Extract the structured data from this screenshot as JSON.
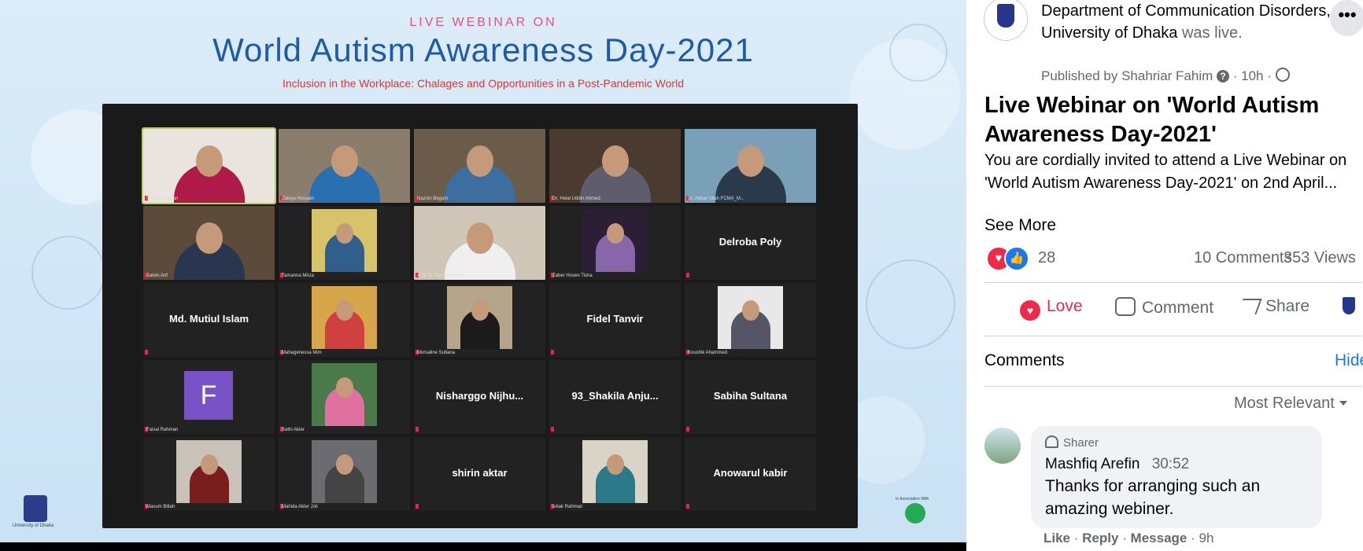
{
  "slide": {
    "kicker": "LIVE WEBINAR ON",
    "title": "World Autism Awareness Day-2021",
    "subtitle": "Inclusion in the Workplace: Chalages and Opportunities in a Post-Pandemic World",
    "logo_left_caption": "University of Dhaka",
    "logo_right_caption": "In Association With"
  },
  "participants": [
    {
      "caption": "Sharmin Jahan",
      "name": "",
      "kind": "video"
    },
    {
      "caption": "Zakiya Hossain",
      "name": "",
      "kind": "video"
    },
    {
      "caption": "Naznin Begum",
      "name": "",
      "kind": "video"
    },
    {
      "caption": "Dr. Helal Uddin Ahmed",
      "name": "",
      "kind": "video"
    },
    {
      "caption": "Dr. Akbar Ullah FCMA_M...",
      "name": "",
      "kind": "video"
    },
    {
      "caption": "Sakim Arif",
      "name": "",
      "kind": "video"
    },
    {
      "caption": "Tamanna Mirza",
      "name": "",
      "kind": "video-small"
    },
    {
      "caption": "A. K. M. Rakibul Karim",
      "name": "",
      "kind": "video"
    },
    {
      "caption": "Zaber Hosen Tisha",
      "name": "",
      "kind": "video-small"
    },
    {
      "caption": "",
      "name": "Delroba Poly",
      "kind": "name"
    },
    {
      "caption": "",
      "name": "Md. Mutiul Islam",
      "kind": "name"
    },
    {
      "caption": "Mahagenessa Mim",
      "name": "",
      "kind": "video-small"
    },
    {
      "caption": "Morsaline Sultana",
      "name": "",
      "kind": "video-small"
    },
    {
      "caption": "",
      "name": "Fidel Tanvir",
      "kind": "name"
    },
    {
      "caption": "Koushik Ahammed",
      "name": "",
      "kind": "video-small"
    },
    {
      "caption": "Faisal Rahman",
      "name": "F",
      "kind": "avatar"
    },
    {
      "caption": "Sathi Akter",
      "name": "",
      "kind": "video-small"
    },
    {
      "caption": "",
      "name": "Nisharggo  Nijhu...",
      "kind": "name"
    },
    {
      "caption": "",
      "name": "93_Shakila  Anju...",
      "kind": "name"
    },
    {
      "caption": "",
      "name": "Sabiha Sultana",
      "kind": "name"
    },
    {
      "caption": "Masum Billah",
      "name": "",
      "kind": "video-small"
    },
    {
      "caption": "Mahida Akter Joli",
      "name": "",
      "kind": "video-small"
    },
    {
      "caption": "",
      "name": "shirin aktar",
      "kind": "name"
    },
    {
      "caption": "Istiak Rahman",
      "name": "",
      "kind": "video-small"
    },
    {
      "caption": "",
      "name": "Anowarul kabir",
      "kind": "name"
    }
  ],
  "post": {
    "page_name": "Department of Communication Disorders, University of Dhaka",
    "was_live": "was live.",
    "published_by": "Published by Shahriar Fahim",
    "help_glyph": "?",
    "time": "10h",
    "more_glyph": "•••",
    "title": "Live Webinar on 'World Autism Awareness Day-2021'",
    "body": "You are cordially invited to attend a Live Webinar on 'World Autism Awareness Day-2021' on 2nd April...",
    "see_more": "See More",
    "reaction_count": "28",
    "comments_count": "10 Comments",
    "views_count": "353 Views",
    "love_glyph": "♥",
    "like_glyph": "👍"
  },
  "actions": {
    "love": "Love",
    "comment": "Comment",
    "share": "Share"
  },
  "comments": {
    "label": "Comments",
    "hide": "Hide",
    "sort": "Most Relevant",
    "items": [
      {
        "badge": "Sharer",
        "author": "Mashfiq Arefin",
        "time": "30:52",
        "text": "Thanks for arranging such an amazing webiner.",
        "like": "Like",
        "reply": "Reply",
        "message": "Message",
        "age": "9h"
      }
    ]
  },
  "icons": {
    "react_love": "heart-icon",
    "react_like": "thumbs-up-icon",
    "comment": "speech-bubble-icon",
    "share": "share-arrow-icon",
    "globe": "globe-icon"
  }
}
